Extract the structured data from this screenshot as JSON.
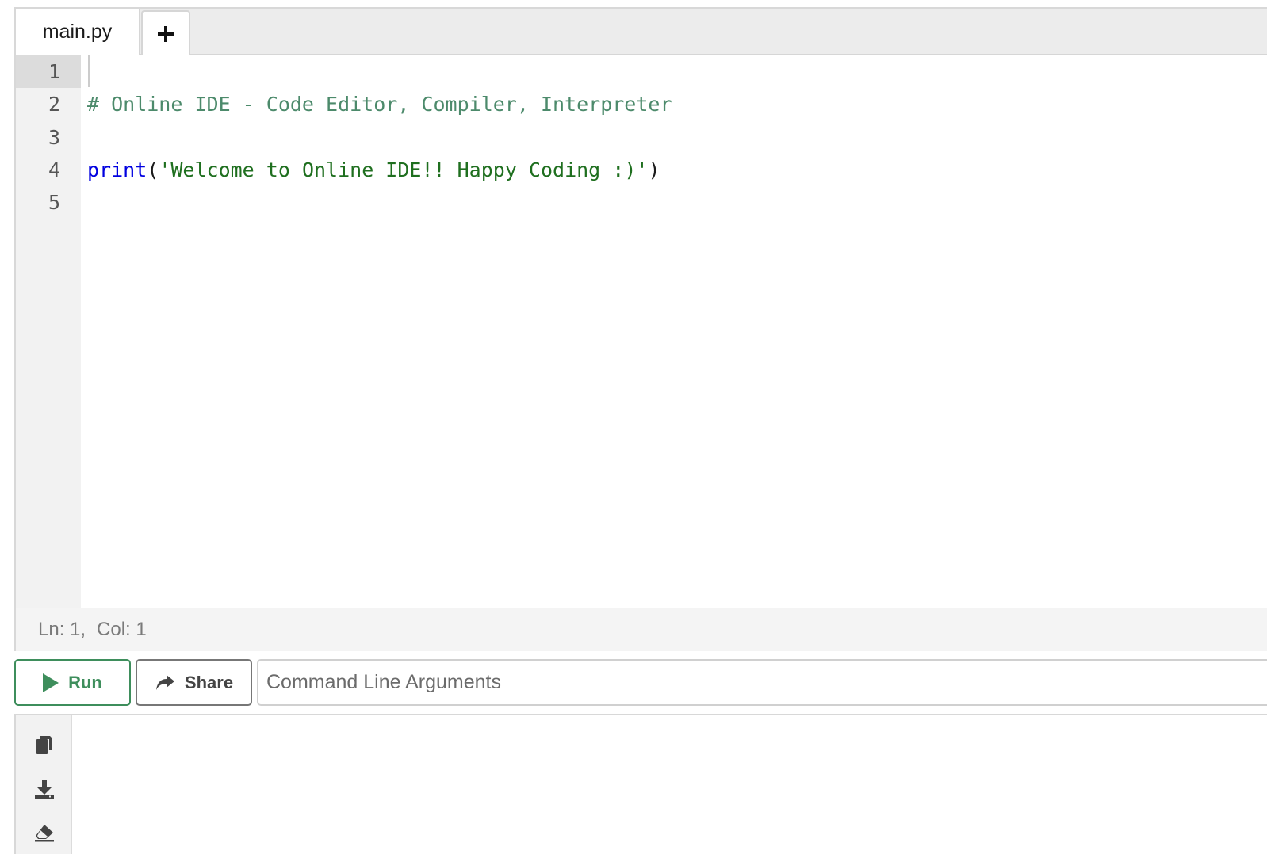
{
  "tabs": {
    "active_file": "main.py",
    "add_label": "+"
  },
  "editor": {
    "line_numbers": [
      "1",
      "2",
      "3",
      "4",
      "5"
    ],
    "active_line": 1,
    "lines": {
      "l2_comment": "# Online IDE - Code Editor, Compiler, Interpreter",
      "l4_keyword": "print",
      "l4_open": "(",
      "l4_string": "'Welcome to Online IDE!! Happy Coding :)'",
      "l4_close": ")"
    }
  },
  "status": {
    "line": "Ln: 1,",
    "col": "Col: 1"
  },
  "controls": {
    "run_label": "Run",
    "share_label": "Share",
    "args_placeholder": "Command Line Arguments"
  },
  "output_tools": [
    "copy-icon",
    "download-icon",
    "eraser-icon"
  ],
  "colors": {
    "run_accent": "#3e8e5c",
    "keyword": "#0000e0",
    "string": "#1f6f1f",
    "comment": "#4c8a6b"
  }
}
